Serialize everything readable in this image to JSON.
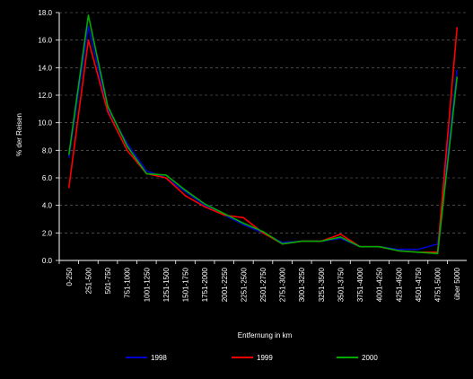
{
  "chart_data": {
    "type": "line",
    "title": "",
    "xlabel": "Entfernung in km",
    "ylabel": "% der Reisen",
    "ylim": [
      0,
      18
    ],
    "yticks": [
      "0.0",
      "2.0",
      "4.0",
      "6.0",
      "8.0",
      "10.0",
      "12.0",
      "14.0",
      "16.0",
      "18.0"
    ],
    "grid": true,
    "legend_position": "bottom",
    "categories": [
      "0-250",
      "251-500",
      "501-750",
      "751-1000",
      "1001-1250",
      "1251-1500",
      "1501-1750",
      "1751-2000",
      "2001-2250",
      "2251-2500",
      "2501-2750",
      "2751-3000",
      "3001-3250",
      "3251-3500",
      "3501-3750",
      "3751-4000",
      "4001-4250",
      "4251-4500",
      "4501-4750",
      "4751-5000",
      "über 5000"
    ],
    "series": [
      {
        "name": "1998",
        "color": "#0000cc",
        "values": [
          7.5,
          17.0,
          11.0,
          8.5,
          6.5,
          6.0,
          5.0,
          4.0,
          3.3,
          2.6,
          2.0,
          1.3,
          1.4,
          1.4,
          1.6,
          1.0,
          1.0,
          0.8,
          0.8,
          1.2,
          13.8
        ]
      },
      {
        "name": "1999",
        "color": "#ff0000",
        "values": [
          5.3,
          16.0,
          10.8,
          8.0,
          6.3,
          6.0,
          4.7,
          3.9,
          3.3,
          3.1,
          2.0,
          1.2,
          1.4,
          1.4,
          1.9,
          1.0,
          1.0,
          0.7,
          0.6,
          0.6,
          16.9
        ]
      },
      {
        "name": "2000",
        "color": "#00aa00",
        "values": [
          7.7,
          17.8,
          11.2,
          8.3,
          6.3,
          6.2,
          5.1,
          4.1,
          3.4,
          2.7,
          2.1,
          1.2,
          1.4,
          1.4,
          1.7,
          1.0,
          1.0,
          0.7,
          0.6,
          0.5,
          13.3
        ]
      }
    ]
  }
}
